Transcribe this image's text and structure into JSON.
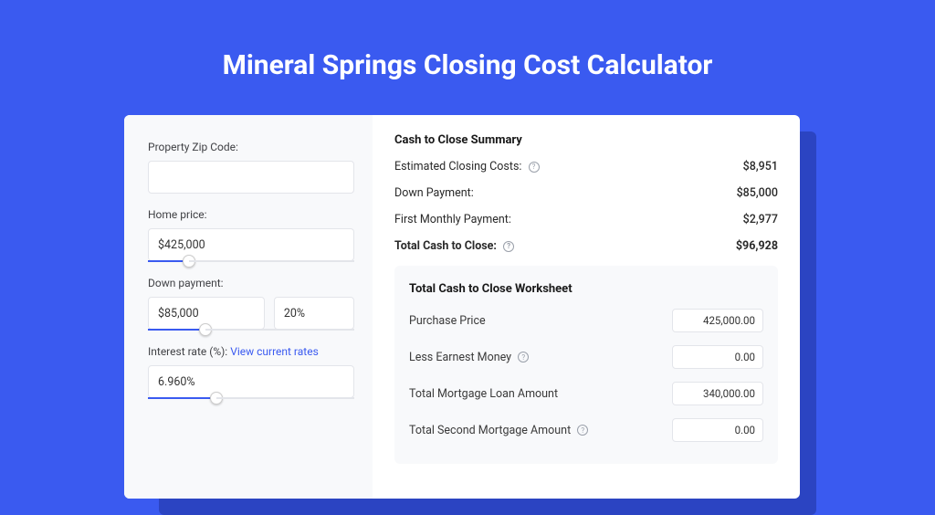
{
  "title": "Mineral Springs Closing Cost Calculator",
  "left": {
    "zipLabel": "Property Zip Code:",
    "zipValue": "",
    "homePriceLabel": "Home price:",
    "homePriceValue": "$425,000",
    "downPaymentLabel": "Down payment:",
    "downPaymentValue": "$85,000",
    "downPaymentPct": "20%",
    "interestLabel": "Interest rate (%): ",
    "interestLink": "View current rates",
    "interestValue": "6.960%"
  },
  "summary": {
    "heading": "Cash to Close Summary",
    "rows": [
      {
        "label": "Estimated Closing Costs:",
        "help": true,
        "value": "$8,951"
      },
      {
        "label": "Down Payment:",
        "help": false,
        "value": "$85,000"
      },
      {
        "label": "First Monthly Payment:",
        "help": false,
        "value": "$2,977"
      }
    ],
    "total": {
      "label": "Total Cash to Close:",
      "help": true,
      "value": "$96,928"
    }
  },
  "worksheet": {
    "heading": "Total Cash to Close Worksheet",
    "rows": [
      {
        "label": "Purchase Price",
        "help": false,
        "value": "425,000.00"
      },
      {
        "label": "Less Earnest Money",
        "help": true,
        "value": "0.00"
      },
      {
        "label": "Total Mortgage Loan Amount",
        "help": false,
        "value": "340,000.00"
      },
      {
        "label": "Total Second Mortgage Amount",
        "help": true,
        "value": "0.00"
      }
    ]
  }
}
